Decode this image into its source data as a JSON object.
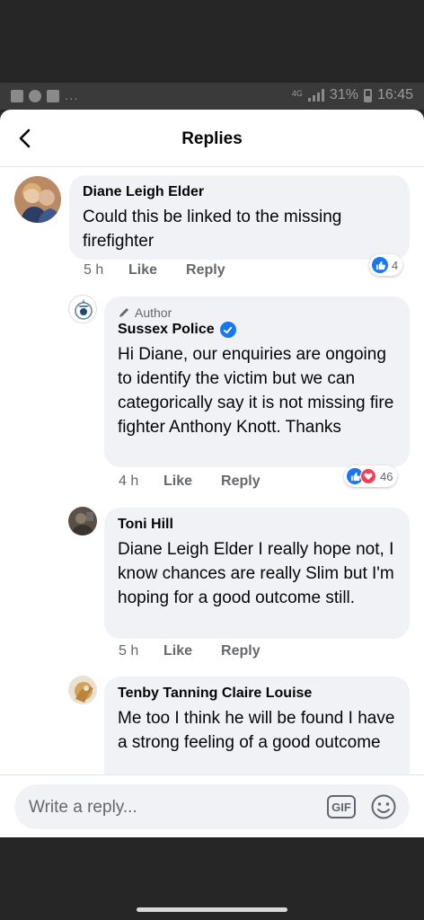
{
  "status_bar": {
    "left_icons": [
      "facebook-icon",
      "messenger-icon",
      "facebook-icon"
    ],
    "dots": "...",
    "network": "4G",
    "battery": "31%",
    "time": "16:45"
  },
  "header": {
    "title": "Replies",
    "back_icon": "chevron-left-icon"
  },
  "comments": [
    {
      "name": "Diane Leigh Elder",
      "text": "Could this be linked to the missing firefighter",
      "time": "5 h",
      "like_label": "Like",
      "reply_label": "Reply",
      "reactions": {
        "types": [
          "like"
        ],
        "count": "4"
      }
    },
    {
      "author_label": "Author",
      "name": "Sussex Police",
      "verified": true,
      "text": "Hi Diane, our enquiries are ongoing to identify the victim but we can categorically say it is not missing fire fighter Anthony Knott. Thanks",
      "time": "4 h",
      "like_label": "Like",
      "reply_label": "Reply",
      "reactions": {
        "types": [
          "like",
          "love"
        ],
        "count": "46"
      }
    },
    {
      "name": "Toni Hill",
      "text": "Diane Leigh Elder I really hope not, I know chances are really Slim but I'm hoping for a good outcome still.",
      "time": "5 h",
      "like_label": "Like",
      "reply_label": "Reply"
    },
    {
      "name": "Tenby Tanning Claire Louise",
      "text": "Me too I think he will be found I have a strong feeling of a good outcome"
    }
  ],
  "composer": {
    "placeholder": "Write a reply...",
    "gif_label": "GIF",
    "emoji_icon": "smiley-icon"
  },
  "colors": {
    "accent": "#1877f2",
    "love": "#f33e58",
    "bubble": "#f0f2f5",
    "secondary_text": "#65676b"
  }
}
